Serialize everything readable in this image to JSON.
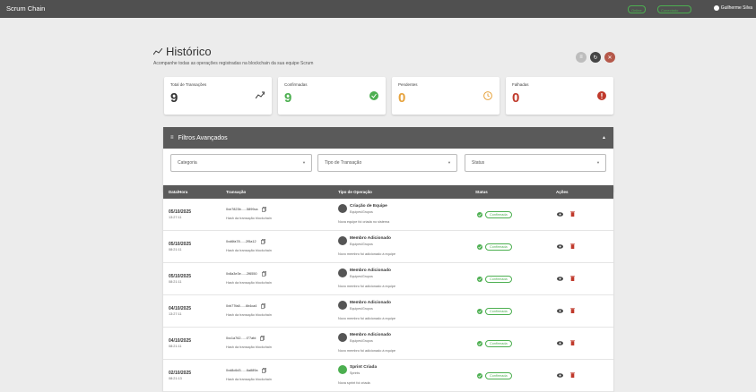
{
  "header": {
    "brand": "Scrum Chain",
    "network_label": "Conectado",
    "badge_label": "Online",
    "user_name": "Guilherme Silva"
  },
  "page": {
    "title": "Histórico",
    "subtitle": "Acompanhe todas as operações registradas na blockchain da sua equipe Scrum"
  },
  "stats": [
    {
      "label": "Total de Transações",
      "value": "9",
      "color": "#333333",
      "icon": "trending-up-icon"
    },
    {
      "label": "Confirmadas",
      "value": "9",
      "color": "#4caf50",
      "icon": "check-circle-icon"
    },
    {
      "label": "Pendentes",
      "value": "0",
      "color": "#e6a23c",
      "icon": "clock-icon"
    },
    {
      "label": "Falhadas",
      "value": "0",
      "color": "#c0392b",
      "icon": "error-icon"
    }
  ],
  "filters": {
    "title": "Filtros Avançados",
    "category": "Categoria",
    "type": "Tipo de Transação",
    "status": "Status"
  },
  "table": {
    "headers": {
      "date": "Data/Hora",
      "tx": "Transação",
      "op": "Tipo de Operação",
      "status": "Status",
      "actions": "Ações"
    },
    "rows": [
      {
        "date": "05/10/2025",
        "time": "13:27:11",
        "hash": "0xe7823b......5899ca",
        "hash_desc": "Hash da transação blockchain",
        "op_title": "Criação de Equipe",
        "op_cat": "Equipes/Grupos",
        "op_desc": "Nova equipe foi criada no sistema",
        "status": "Confirmada",
        "icon": "group-icon"
      },
      {
        "date": "05/10/2025",
        "time": "08:21:11",
        "hash": "0xd6fa78......2f5a12",
        "hash_desc": "Hash da transação blockchain",
        "op_title": "Membro Adicionado",
        "op_cat": "Equipes/Grupos",
        "op_desc": "Novo membro foi adicionado à equipe",
        "status": "Confirmada",
        "icon": "group-icon"
      },
      {
        "date": "05/10/2025",
        "time": "08:21:11",
        "hash": "0x8a3e3e......2f6550",
        "hash_desc": "Hash da transação blockchain",
        "op_title": "Membro Adicionado",
        "op_cat": "Equipes/Grupos",
        "op_desc": "Novo membro foi adicionado à equipe",
        "status": "Confirmada",
        "icon": "group-icon"
      },
      {
        "date": "04/10/2025",
        "time": "13:27:11",
        "hash": "0xb77fa8......6b4ca4",
        "hash_desc": "Hash da transação blockchain",
        "op_title": "Membro Adicionado",
        "op_cat": "Equipes/Grupos",
        "op_desc": "Novo membro foi adicionado à equipe",
        "status": "Confirmada",
        "icon": "group-icon"
      },
      {
        "date": "04/10/2025",
        "time": "08:21:11",
        "hash": "0xc1a762......f77afd",
        "hash_desc": "Hash da transação blockchain",
        "op_title": "Membro Adicionado",
        "op_cat": "Equipes/Grupos",
        "op_desc": "Novo membro foi adicionado à equipe",
        "status": "Confirmada",
        "icon": "group-icon"
      },
      {
        "date": "02/10/2025",
        "time": "08:21:13",
        "hash": "0xd8c6d3......6a889a",
        "hash_desc": "Hash da transação blockchain",
        "op_title": "Sprint Criada",
        "op_cat": "Sprints",
        "op_desc": "Nova sprint foi criada",
        "status": "Confirmada",
        "icon": "sprint-icon"
      }
    ]
  }
}
